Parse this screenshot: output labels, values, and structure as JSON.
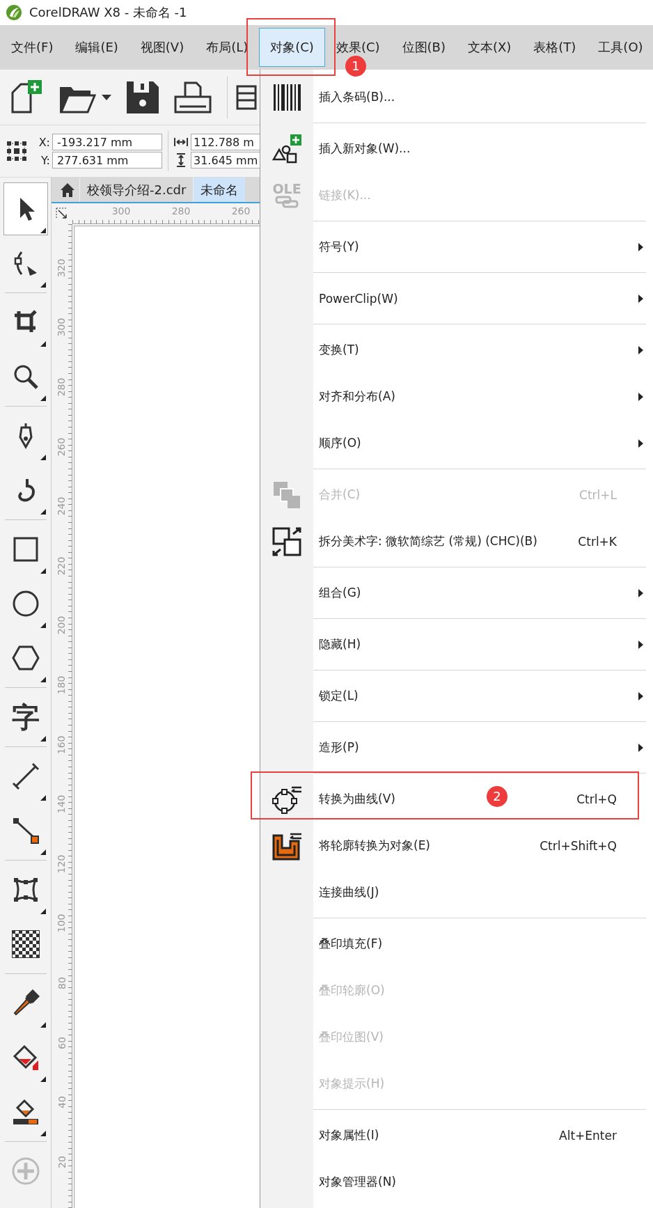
{
  "window": {
    "title": "CorelDRAW X8 - 未命名 -1"
  },
  "menu_bar": [
    {
      "label": "文件(F)",
      "selected": false
    },
    {
      "label": "编辑(E)",
      "selected": false
    },
    {
      "label": "视图(V)",
      "selected": false
    },
    {
      "label": "布局(L)",
      "selected": false
    },
    {
      "label": "对象(C)",
      "selected": true,
      "callout": "1"
    },
    {
      "label": "效果(C)",
      "selected": false
    },
    {
      "label": "位图(B)",
      "selected": false
    },
    {
      "label": "文本(X)",
      "selected": false
    },
    {
      "label": "表格(T)",
      "selected": false
    },
    {
      "label": "工具(O)",
      "selected": false
    }
  ],
  "property_bar": {
    "x_label": "X:",
    "x_value": "-193.217 mm",
    "y_label": "Y:",
    "y_value": "277.631 mm",
    "width_value": "112.788 m",
    "height_value": "31.645 mm"
  },
  "document_tabs": [
    {
      "label": "校领导介绍-2.cdr",
      "selected": false
    },
    {
      "label": "未命名",
      "selected": true
    }
  ],
  "rulers": {
    "horizontal": [
      "300",
      "280",
      "260"
    ],
    "vertical": [
      "320",
      "300",
      "280",
      "260",
      "240",
      "220",
      "200",
      "180",
      "160",
      "140",
      "120",
      "100",
      "80",
      "60",
      "40",
      "20"
    ]
  },
  "toolbox": {
    "groups": [
      {
        "tools": [
          {
            "kind": "pick",
            "selected": true,
            "flyout": true
          },
          {
            "kind": "shape",
            "selected": false,
            "flyout": true
          }
        ]
      },
      {
        "tools": [
          {
            "kind": "crop",
            "selected": false,
            "flyout": true
          },
          {
            "kind": "zoom",
            "selected": false,
            "flyout": true
          }
        ]
      },
      {
        "tools": [
          {
            "kind": "pen",
            "selected": false,
            "flyout": true
          },
          {
            "kind": "curve",
            "selected": false,
            "flyout": true
          }
        ]
      },
      {
        "tools": [
          {
            "kind": "rectangle",
            "selected": false,
            "flyout": true
          },
          {
            "kind": "ellipse",
            "selected": false,
            "flyout": true
          },
          {
            "kind": "polygon",
            "selected": false,
            "flyout": true
          }
        ]
      },
      {
        "tools": [
          {
            "kind": "text",
            "glyph": "字",
            "selected": false,
            "flyout": true
          }
        ]
      },
      {
        "tools": [
          {
            "kind": "dimension",
            "selected": false,
            "flyout": true
          },
          {
            "kind": "connector",
            "selected": false,
            "flyout": true
          }
        ]
      },
      {
        "tools": [
          {
            "kind": "envelope",
            "selected": false,
            "flyout": true
          },
          {
            "kind": "transparency",
            "selected": false,
            "flyout": false
          }
        ]
      },
      {
        "tools": [
          {
            "kind": "eyedropper",
            "selected": false,
            "flyout": true
          },
          {
            "kind": "fill",
            "selected": false,
            "flyout": true
          },
          {
            "kind": "smart_fill",
            "selected": false,
            "flyout": true
          }
        ]
      },
      {
        "tools": [
          {
            "kind": "add",
            "selected": false,
            "flyout": false
          }
        ]
      }
    ]
  },
  "object_menu": {
    "items": [
      {
        "label": "插入条码(B)...",
        "disabled": false,
        "submenu": false,
        "separator_after": true
      },
      {
        "label": "插入新对象(W)...",
        "disabled": false,
        "submenu": false,
        "separator_after": false
      },
      {
        "label": "链接(K)...",
        "icon_text": "OLE",
        "disabled": true,
        "submenu": false,
        "separator_after": true
      },
      {
        "label": "符号(Y)",
        "disabled": false,
        "submenu": true,
        "separator_after": true
      },
      {
        "label": "PowerClip(W)",
        "disabled": false,
        "submenu": true,
        "separator_after": true
      },
      {
        "label": "变换(T)",
        "disabled": false,
        "submenu": true,
        "separator_after": false
      },
      {
        "label": "对齐和分布(A)",
        "disabled": false,
        "submenu": true,
        "separator_after": false
      },
      {
        "label": "顺序(O)",
        "disabled": false,
        "submenu": true,
        "separator_after": true
      },
      {
        "label": "合并(C)",
        "shortcut": "Ctrl+L",
        "disabled": true,
        "submenu": false,
        "separator_after": false
      },
      {
        "label": "拆分美术字: 微软简综艺 (常规) (CHC)(B)",
        "shortcut": "Ctrl+K",
        "disabled": false,
        "submenu": false,
        "separator_after": true
      },
      {
        "label": "组合(G)",
        "disabled": false,
        "submenu": true,
        "separator_after": true
      },
      {
        "label": "隐藏(H)",
        "disabled": false,
        "submenu": true,
        "separator_after": true
      },
      {
        "label": "锁定(L)",
        "disabled": false,
        "submenu": true,
        "separator_after": true
      },
      {
        "label": "造形(P)",
        "disabled": false,
        "submenu": true,
        "separator_after": true
      },
      {
        "label": "转换为曲线(V)",
        "shortcut": "Ctrl+Q",
        "disabled": false,
        "submenu": false,
        "separator_after": false,
        "callout": "2"
      },
      {
        "label": "将轮廓转换为对象(E)",
        "shortcut": "Ctrl+Shift+Q",
        "disabled": false,
        "submenu": false,
        "separator_after": false
      },
      {
        "label": "连接曲线(J)",
        "disabled": false,
        "submenu": false,
        "separator_after": true
      },
      {
        "label": "叠印填充(F)",
        "disabled": false,
        "submenu": false,
        "separator_after": false
      },
      {
        "label": "叠印轮廓(O)",
        "disabled": true,
        "submenu": false,
        "separator_after": false
      },
      {
        "label": "叠印位图(V)",
        "disabled": true,
        "submenu": false,
        "separator_after": false
      },
      {
        "label": "对象提示(H)",
        "disabled": true,
        "submenu": false,
        "separator_after": true
      },
      {
        "label": "对象属性(I)",
        "shortcut": "Alt+Enter",
        "disabled": false,
        "submenu": false,
        "separator_after": false
      },
      {
        "label": "对象管理器(N)",
        "disabled": false,
        "submenu": false,
        "separator_after": false
      }
    ]
  }
}
